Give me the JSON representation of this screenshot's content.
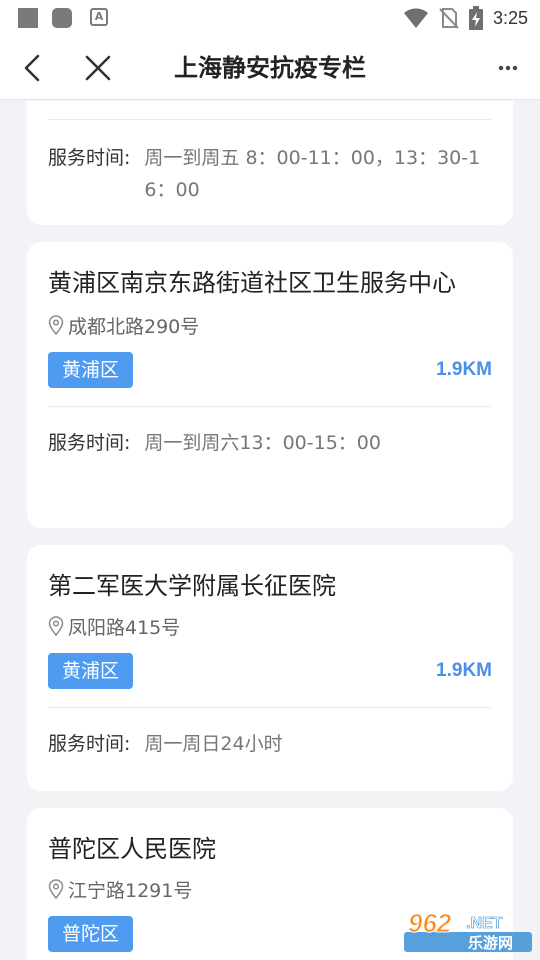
{
  "status_bar": {
    "time": "3:25",
    "icons": [
      "notification-square-icon",
      "notification-rounded-icon",
      "font-a-icon",
      "wifi-icon",
      "no-sim-icon",
      "battery-charging-icon"
    ]
  },
  "nav": {
    "title": "上海静安抗疫专栏",
    "icons": [
      "back-arrow-icon",
      "close-icon",
      "more-dots-icon"
    ]
  },
  "cards": [
    {
      "service_label": "服务时间:",
      "service_time": "周一到周五 8：00-11：00，13：30-16：00"
    },
    {
      "name": "黄浦区南京东路街道社区卫生服务中心",
      "address": "成都北路290号",
      "district": "黄浦区",
      "distance": "1.9KM",
      "service_label": "服务时间:",
      "service_time": "周一到周六13：00-15：00"
    },
    {
      "name": "第二军医大学附属长征医院",
      "address": "凤阳路415号",
      "district": "黄浦区",
      "distance": "1.9KM",
      "service_label": "服务时间:",
      "service_time": "周一周日24小时"
    },
    {
      "name": "普陀区人民医院",
      "address": "江宁路1291号",
      "district": "普陀区"
    }
  ],
  "watermark": {
    "number": "962",
    "suffix": ".NET",
    "site": "乐游网"
  },
  "colors": {
    "accent": "#4e9bf0",
    "distance": "#4a8fe8",
    "background": "#f2f3f7"
  }
}
